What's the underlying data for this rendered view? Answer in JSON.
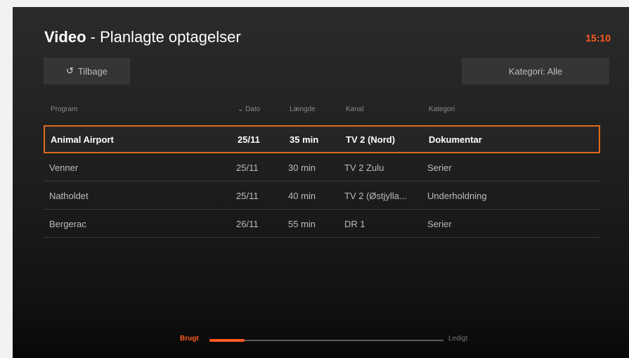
{
  "header": {
    "title_bold": "Video",
    "title_sep": " - ",
    "title_rest": "Planlagte optagelser",
    "clock": "15:10"
  },
  "buttons": {
    "back_icon": "↺",
    "back_label": "Tilbage",
    "category_label": "Kategori: Alle"
  },
  "table": {
    "headers": {
      "program": "Program",
      "date": "⌄ Dato",
      "length": "Længde",
      "channel": "Kanal",
      "category": "Kategori"
    },
    "rows": [
      {
        "program": "Animal Airport",
        "date": "25/11",
        "length": "35 min",
        "channel": "TV 2 (Nord)",
        "category": "Dokumentar"
      },
      {
        "program": "Venner",
        "date": "25/11",
        "length": "30 min",
        "channel": "TV 2 Zulu",
        "category": "Serier"
      },
      {
        "program": "Natholdet",
        "date": "25/11",
        "length": "40 min",
        "channel": "TV 2 (Østjylla...",
        "category": "Underholdning"
      },
      {
        "program": "Bergerac",
        "date": "26/11",
        "length": "55 min",
        "channel": "DR 1",
        "category": "Serier"
      }
    ]
  },
  "storage": {
    "used_label": "Brugt",
    "free_label": "Ledigt",
    "used_fraction": 0.15
  },
  "colors": {
    "accent": "#ff5a1f",
    "selection_border": "#e06a1e"
  }
}
